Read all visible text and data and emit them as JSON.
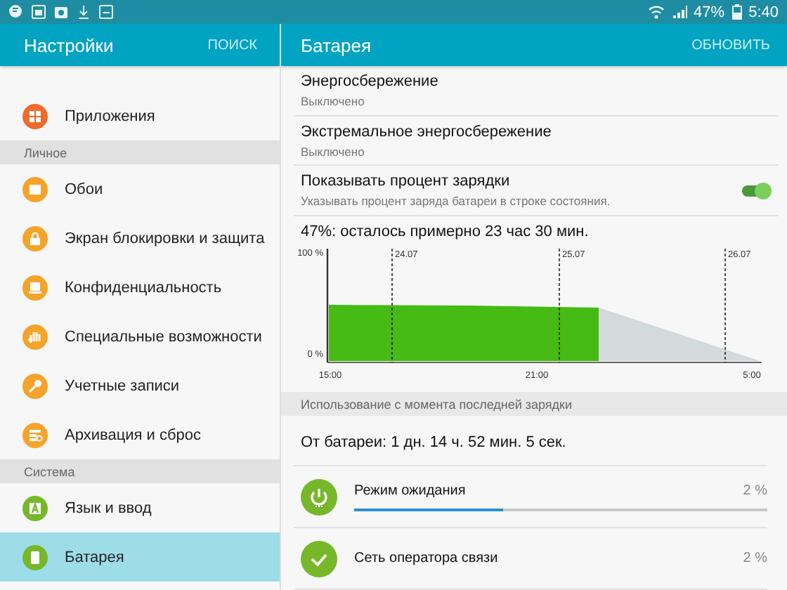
{
  "status_bar": {
    "battery_percent": "47%",
    "time": "5:40"
  },
  "settings_pane": {
    "title": "Настройки",
    "search_button": "ПОИСК",
    "items": [
      {
        "kind": "item",
        "label": "Приложения",
        "color": "#f06a2b",
        "selected": false
      },
      {
        "kind": "header",
        "label": "Личное"
      },
      {
        "kind": "item",
        "label": "Обои",
        "color": "#f5a32a",
        "selected": false
      },
      {
        "kind": "item",
        "label": "Экран блокировки и защита",
        "color": "#f5a32a",
        "selected": false
      },
      {
        "kind": "item",
        "label": "Конфиденциальность",
        "color": "#f5a32a",
        "selected": false
      },
      {
        "kind": "item",
        "label": "Специальные возможности",
        "color": "#f5a32a",
        "selected": false
      },
      {
        "kind": "item",
        "label": "Учетные записи",
        "color": "#f5a32a",
        "selected": false
      },
      {
        "kind": "item",
        "label": "Архивация и сброс",
        "color": "#f5a32a",
        "selected": false
      },
      {
        "kind": "header",
        "label": "Система"
      },
      {
        "kind": "item",
        "label": "Язык и ввод",
        "color": "#76b82a",
        "selected": false
      },
      {
        "kind": "item",
        "label": "Батарея",
        "color": "#76b82a",
        "selected": true
      }
    ]
  },
  "battery_pane": {
    "title": "Батарея",
    "refresh_button": "ОБНОВИТЬ",
    "settings": [
      {
        "kind": "text",
        "title": "Энергосбережение",
        "subtitle": "Выключено"
      },
      {
        "kind": "text",
        "title": "Экстремальное энергосбережение",
        "subtitle": "Выключено"
      },
      {
        "kind": "toggle",
        "title": "Показывать процент зарядки",
        "subtitle": "Указывать процент заряда батареи в строке состояния.",
        "on": true
      }
    ],
    "estimate": "47%: осталось примерно 23 час 30 мин.",
    "graph": {
      "y_labels": [
        "100 %",
        "0 %"
      ],
      "date_labels": [
        "24.07",
        "25.07",
        "26.07"
      ],
      "x_labels": [
        "15:00",
        "21:00",
        "5:00"
      ]
    },
    "usage_header": "Использование с момента последней зарядки",
    "on_battery": "От батареи: 1 дн. 14 ч. 52 мин. 5 сек.",
    "usage": [
      {
        "name": "Режим ожидания",
        "percent": "2 %",
        "level": 0.36
      },
      {
        "name": "Сеть оператора связи",
        "percent": "2 %"
      }
    ]
  }
}
